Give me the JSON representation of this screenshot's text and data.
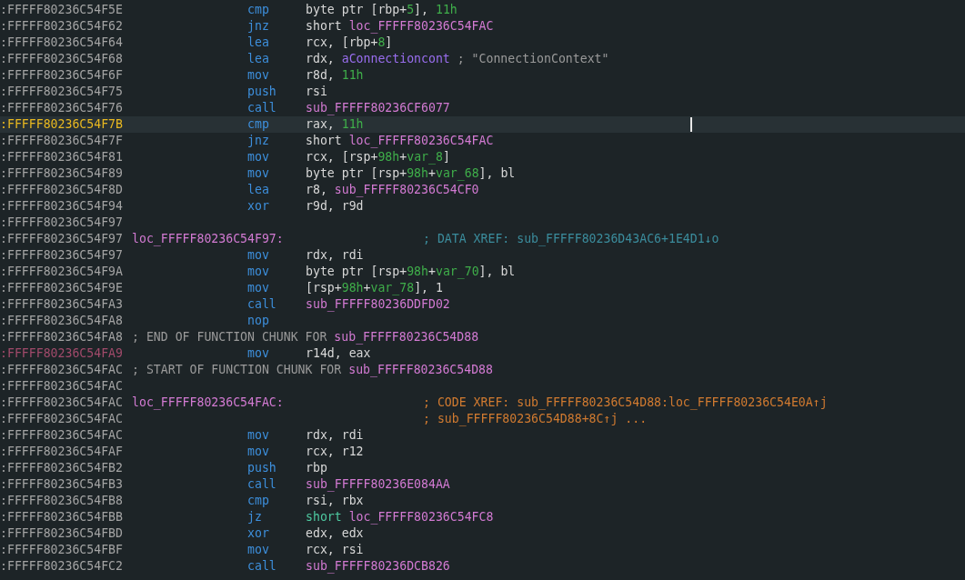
{
  "lines": [
    {
      "address": ":FFFFF80236C54F5E",
      "kind": "instr",
      "selected": false,
      "mnemonic": "cmp",
      "operands": [
        {
          "kind": "plain",
          "text": "byte ptr [rbp+"
        },
        {
          "kind": "number",
          "text": "5"
        },
        {
          "kind": "plain",
          "text": "], "
        },
        {
          "kind": "number",
          "text": "11h"
        }
      ]
    },
    {
      "address": ":FFFFF80236C54F62",
      "kind": "instr",
      "selected": false,
      "mnemonic": "jnz",
      "operands": [
        {
          "kind": "plain",
          "text": "short "
        },
        {
          "kind": "name",
          "text": "loc_FFFFF80236C54FAC"
        }
      ]
    },
    {
      "address": ":FFFFF80236C54F64",
      "kind": "instr",
      "selected": false,
      "mnemonic": "lea",
      "operands": [
        {
          "kind": "plain",
          "text": "rcx, [rbp+"
        },
        {
          "kind": "number",
          "text": "8"
        },
        {
          "kind": "plain",
          "text": "]"
        }
      ]
    },
    {
      "address": ":FFFFF80236C54F68",
      "kind": "instr",
      "selected": false,
      "mnemonic": "lea",
      "operands": [
        {
          "kind": "plain",
          "text": "rdx, "
        },
        {
          "kind": "data",
          "text": "aConnectioncont"
        },
        {
          "kind": "comment",
          "text": " ; \"ConnectionContext\""
        }
      ]
    },
    {
      "address": ":FFFFF80236C54F6F",
      "kind": "instr",
      "selected": false,
      "mnemonic": "mov",
      "operands": [
        {
          "kind": "plain",
          "text": "r8d, "
        },
        {
          "kind": "number",
          "text": "11h"
        }
      ]
    },
    {
      "address": ":FFFFF80236C54F75",
      "kind": "instr",
      "selected": false,
      "mnemonic": "push",
      "operands": [
        {
          "kind": "plain",
          "text": "rsi"
        }
      ]
    },
    {
      "address": ":FFFFF80236C54F76",
      "kind": "instr",
      "selected": false,
      "mnemonic": "call",
      "operands": [
        {
          "kind": "name",
          "text": "sub_FFFFF80236CF6077"
        }
      ]
    },
    {
      "address": ":FFFFF80236C54F7B",
      "kind": "instr",
      "selected": true,
      "mnemonic": "cmp",
      "operands": [
        {
          "kind": "plain",
          "text": "rax, "
        },
        {
          "kind": "number",
          "text": "11h"
        }
      ]
    },
    {
      "address": ":FFFFF80236C54F7F",
      "kind": "instr",
      "selected": false,
      "mnemonic": "jnz",
      "operands": [
        {
          "kind": "plain",
          "text": "short "
        },
        {
          "kind": "name",
          "text": "loc_FFFFF80236C54FAC"
        }
      ]
    },
    {
      "address": ":FFFFF80236C54F81",
      "kind": "instr",
      "selected": false,
      "mnemonic": "mov",
      "operands": [
        {
          "kind": "plain",
          "text": "rcx, [rsp+"
        },
        {
          "kind": "number",
          "text": "98h"
        },
        {
          "kind": "plain",
          "text": "+"
        },
        {
          "kind": "number",
          "text": "var_8"
        },
        {
          "kind": "plain",
          "text": "]"
        }
      ]
    },
    {
      "address": ":FFFFF80236C54F89",
      "kind": "instr",
      "selected": false,
      "mnemonic": "mov",
      "operands": [
        {
          "kind": "plain",
          "text": "byte ptr [rsp+"
        },
        {
          "kind": "number",
          "text": "98h"
        },
        {
          "kind": "plain",
          "text": "+"
        },
        {
          "kind": "number",
          "text": "var_68"
        },
        {
          "kind": "plain",
          "text": "], bl"
        }
      ]
    },
    {
      "address": ":FFFFF80236C54F8D",
      "kind": "instr",
      "selected": false,
      "mnemonic": "lea",
      "operands": [
        {
          "kind": "plain",
          "text": "r8, "
        },
        {
          "kind": "name",
          "text": "sub_FFFFF80236C54CF0"
        }
      ]
    },
    {
      "address": ":FFFFF80236C54F94",
      "kind": "instr",
      "selected": false,
      "mnemonic": "xor",
      "operands": [
        {
          "kind": "plain",
          "text": "r9d, r9d"
        }
      ]
    },
    {
      "address": ":FFFFF80236C54F97",
      "kind": "blank",
      "selected": false
    },
    {
      "address": ":FFFFF80236C54F97",
      "kind": "label",
      "selected": false,
      "label": "loc_FFFFF80236C54F97:",
      "comment": [
        {
          "kind": "data_xref",
          "text": "; DATA XREF: sub_FFFFF80236D43AC6+1E4D1↓o"
        }
      ]
    },
    {
      "address": ":FFFFF80236C54F97",
      "kind": "instr",
      "selected": false,
      "mnemonic": "mov",
      "operands": [
        {
          "kind": "plain",
          "text": "rdx, rdi"
        }
      ]
    },
    {
      "address": ":FFFFF80236C54F9A",
      "kind": "instr",
      "selected": false,
      "mnemonic": "mov",
      "operands": [
        {
          "kind": "plain",
          "text": "byte ptr [rsp+"
        },
        {
          "kind": "number",
          "text": "98h"
        },
        {
          "kind": "plain",
          "text": "+"
        },
        {
          "kind": "number",
          "text": "var_70"
        },
        {
          "kind": "plain",
          "text": "], bl"
        }
      ]
    },
    {
      "address": ":FFFFF80236C54F9E",
      "kind": "instr",
      "selected": false,
      "mnemonic": "mov",
      "operands": [
        {
          "kind": "plain",
          "text": "[rsp+"
        },
        {
          "kind": "number",
          "text": "98h"
        },
        {
          "kind": "plain",
          "text": "+"
        },
        {
          "kind": "number",
          "text": "var_78"
        },
        {
          "kind": "plain",
          "text": "], 1"
        }
      ]
    },
    {
      "address": ":FFFFF80236C54FA3",
      "kind": "instr",
      "selected": false,
      "mnemonic": "call",
      "operands": [
        {
          "kind": "name",
          "text": "sub_FFFFF80236DDFD02"
        }
      ]
    },
    {
      "address": ":FFFFF80236C54FA8",
      "kind": "instr",
      "selected": false,
      "mnemonic": "nop"
    },
    {
      "address": ":FFFFF80236C54FA8",
      "kind": "chunk",
      "selected": false,
      "comment": [
        {
          "kind": "comment",
          "text": "; END OF FUNCTION CHUNK FOR "
        },
        {
          "kind": "name",
          "text": "sub_FFFFF80236C54D88"
        }
      ]
    },
    {
      "address": ":FFFFF80236C54FA9",
      "color": "#a04a6a",
      "kind": "instr",
      "selected": false,
      "mnemonic": "mov",
      "operands": [
        {
          "kind": "plain",
          "text": "r14d, eax"
        }
      ]
    },
    {
      "address": ":FFFFF80236C54FAC",
      "kind": "chunk",
      "selected": false,
      "comment": [
        {
          "kind": "comment",
          "text": "; START OF FUNCTION CHUNK FOR "
        },
        {
          "kind": "name",
          "text": "sub_FFFFF80236C54D88"
        }
      ]
    },
    {
      "address": ":FFFFF80236C54FAC",
      "kind": "blank",
      "selected": false
    },
    {
      "address": ":FFFFF80236C54FAC",
      "kind": "label",
      "selected": false,
      "label": "loc_FFFFF80236C54FAC:",
      "comment": [
        {
          "kind": "code_xref",
          "text": "; CODE XREF: sub_FFFFF80236C54D88:loc_FFFFF80236C54E0A↑j"
        }
      ]
    },
    {
      "address": ":FFFFF80236C54FAC",
      "kind": "comment",
      "selected": false,
      "comment": [
        {
          "kind": "code_xref",
          "text": "; sub_FFFFF80236C54D88+8C↑j ..."
        }
      ]
    },
    {
      "address": ":FFFFF80236C54FAC",
      "kind": "instr",
      "selected": false,
      "mnemonic": "mov",
      "operands": [
        {
          "kind": "plain",
          "text": "rdx, rdi"
        }
      ]
    },
    {
      "address": ":FFFFF80236C54FAF",
      "kind": "instr",
      "selected": false,
      "mnemonic": "mov",
      "operands": [
        {
          "kind": "plain",
          "text": "rcx, r12"
        }
      ]
    },
    {
      "address": ":FFFFF80236C54FB2",
      "kind": "instr",
      "selected": false,
      "mnemonic": "push",
      "operands": [
        {
          "kind": "plain",
          "text": "rbp"
        }
      ]
    },
    {
      "address": ":FFFFF80236C54FB3",
      "kind": "instr",
      "selected": false,
      "mnemonic": "call",
      "operands": [
        {
          "kind": "name",
          "text": "sub_FFFFF80236E084AA"
        }
      ]
    },
    {
      "address": ":FFFFF80236C54FB8",
      "kind": "instr",
      "selected": false,
      "mnemonic": "cmp",
      "operands": [
        {
          "kind": "plain",
          "text": "rsi, rbx"
        }
      ]
    },
    {
      "address": ":FFFFF80236C54FBB",
      "kind": "instr",
      "selected": false,
      "mnemonic": "jz",
      "operands": [
        {
          "kind": "keyword",
          "text": "short "
        },
        {
          "kind": "name",
          "text": "loc_FFFFF80236C54FC8"
        }
      ]
    },
    {
      "address": ":FFFFF80236C54FBD",
      "kind": "instr",
      "selected": false,
      "mnemonic": "xor",
      "operands": [
        {
          "kind": "plain",
          "text": "edx, edx"
        }
      ]
    },
    {
      "address": ":FFFFF80236C54FBF",
      "kind": "instr",
      "selected": false,
      "mnemonic": "mov",
      "operands": [
        {
          "kind": "plain",
          "text": "rcx, rsi"
        }
      ]
    },
    {
      "address": ":FFFFF80236C54FC2",
      "kind": "instr",
      "selected": false,
      "mnemonic": "call",
      "operands": [
        {
          "kind": "name",
          "text": "sub_FFFFF80236DCB826"
        }
      ]
    }
  ]
}
